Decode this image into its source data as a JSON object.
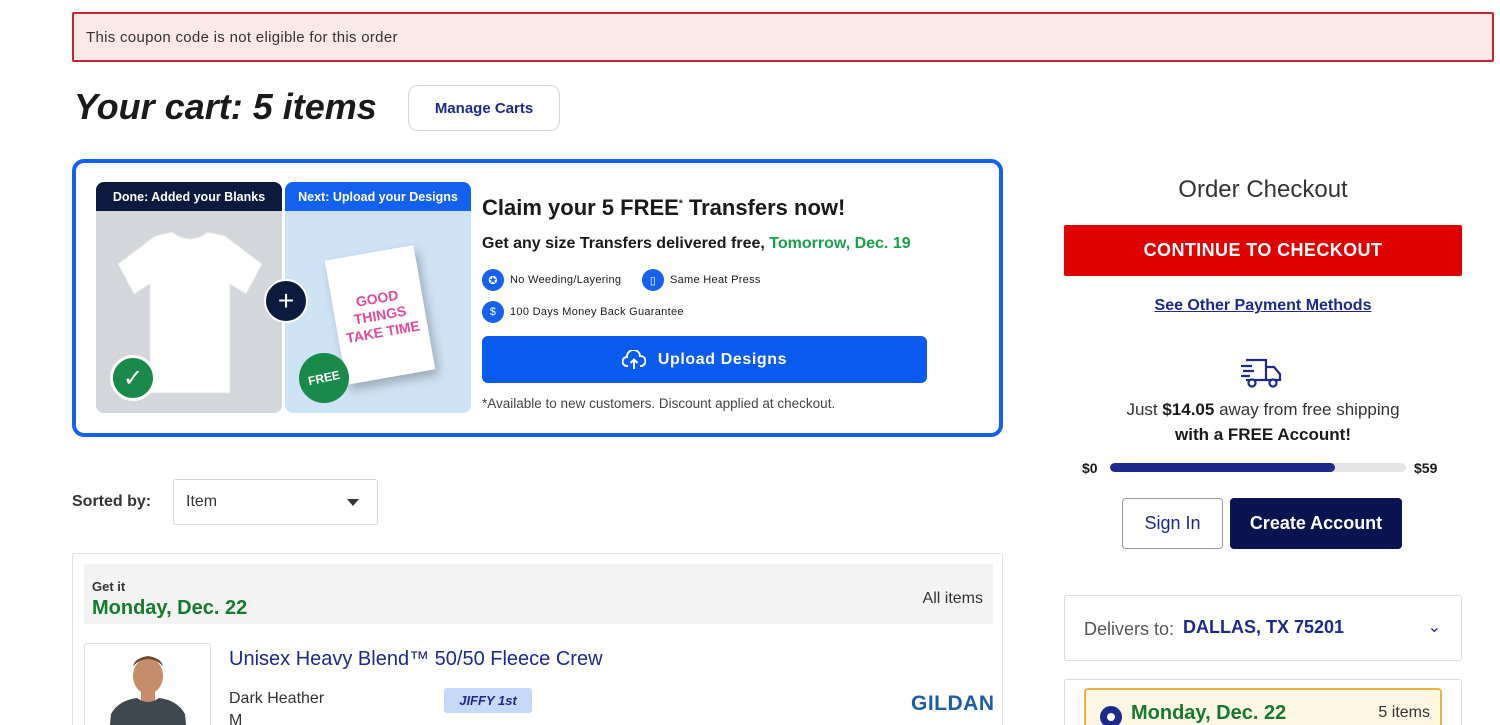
{
  "alert": {
    "text": "This coupon code is not eligible for this order"
  },
  "cart": {
    "title": "Your cart: 5 items",
    "manage_label": "Manage Carts"
  },
  "promo": {
    "step1": "Done: Added your Blanks",
    "step2": "Next: Upload your Designs",
    "free_badge": "FREE",
    "poster_text": "GOOD THINGS TAKE TIME",
    "title": "Claim your 5 FREE",
    "title_sup": "*",
    "title_end": " Transfers now!",
    "subtitle": "Get any size Transfers delivered free, ",
    "subtitle_date": "Tomorrow, Dec. 19",
    "features": [
      "No Weeding/Layering",
      "Same Heat Press",
      "100 Days Money Back Guarantee"
    ],
    "upload_label": "Upload Designs",
    "note": "*Available to new customers. Discount applied at checkout."
  },
  "sort": {
    "label": "Sorted by:",
    "value": "Item"
  },
  "items": {
    "get_it": "Get it",
    "date": "Monday, Dec. 22",
    "all_items": "All items",
    "product": {
      "name": "Unisex Heavy Blend™ 50/50 Fleece Crew",
      "color": "Dark Heather",
      "size": "M",
      "badge": "JIFFY 1st",
      "brand": "GILDAN"
    }
  },
  "checkout": {
    "title": "Order Checkout",
    "continue_label": "CONTINUE TO CHECKOUT",
    "other_payment": "See Other Payment Methods",
    "ship_prefix": "Just ",
    "ship_amount": "$14.05",
    "ship_suffix": " away from free shipping",
    "ship_line2": "with a FREE Account!",
    "progress_min": "$0",
    "progress_max": "$59",
    "progress_fraction": 0.76,
    "signin_label": "Sign In",
    "create_label": "Create Account",
    "delivers_label": "Delivers to:",
    "delivers_value": "DALLAS, TX 75201",
    "ship_option_date": "Monday, Dec. 22",
    "ship_option_count": "5 items"
  },
  "colors": {
    "accent_blue": "#1461f0",
    "navy": "#1d2a8a",
    "checkout_red": "#e00000",
    "green": "#157a2e"
  }
}
